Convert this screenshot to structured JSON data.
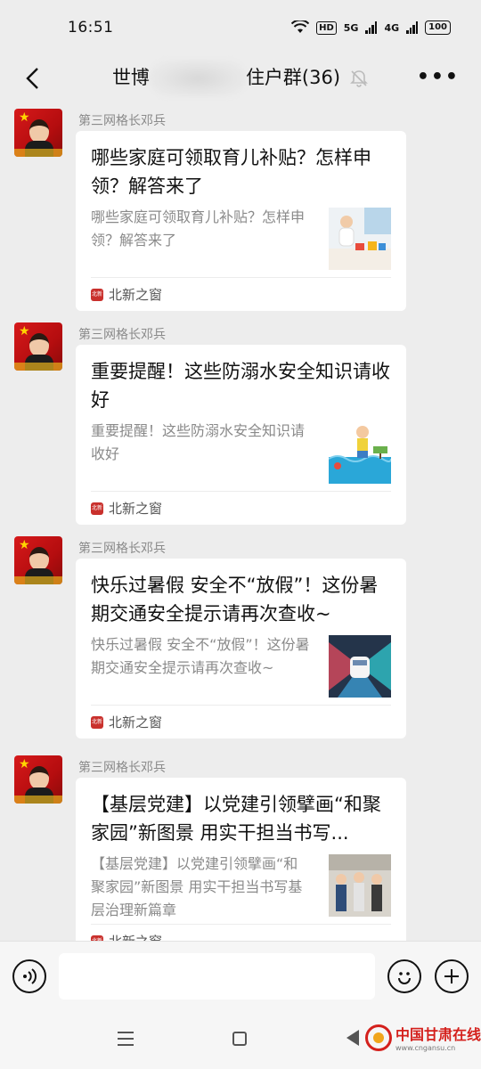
{
  "status_bar": {
    "time": "16:51",
    "hd_label": "HD",
    "net1": "5G",
    "net2": "4G",
    "battery": "100"
  },
  "header": {
    "title_prefix": "世博",
    "title_suffix": "住户群(36)",
    "back_icon": "chevron-left-icon",
    "mute_icon": "bell-off-icon",
    "more_icon": "more-icon"
  },
  "messages": [
    {
      "sender": "第三网格长邓兵",
      "title": "哪些家庭可领取育儿补贴？怎样申领？解答来了",
      "desc": "哪些家庭可领取育儿补贴？怎样申领？解答来了",
      "source": "北新之窗",
      "thumb": "baby-photo"
    },
    {
      "sender": "第三网格长邓兵",
      "title": "重要提醒！这些防溺水安全知识请收好",
      "desc": "重要提醒！这些防溺水安全知识请收好",
      "source": "北新之窗",
      "thumb": "water-safety-cartoon"
    },
    {
      "sender": "第三网格长邓兵",
      "title": "快乐过暑假 安全不“放假”！这份暑期交通安全提示请再次查收~",
      "desc": "快乐过暑假 安全不“放假”！这份暑期交通安全提示请再次查收~",
      "source": "北新之窗",
      "thumb": "car-blind-spot-diagram"
    },
    {
      "sender": "第三网格长邓兵",
      "title": "【基层党建】以党建引领擘画“和聚家园”新图景 用实干担当书写...",
      "desc": "【基层党建】以党建引领擘画“和聚家园”新图景 用实干担当书写基层治理新篇章",
      "source": "北新之窗",
      "thumb": "community-meeting-photo"
    }
  ],
  "input_bar": {
    "voice_icon": "voice-icon",
    "emoji_icon": "emoji-icon",
    "add_icon": "plus-icon",
    "input_value": ""
  },
  "watermark": {
    "main": "中国甘肃在线",
    "sub": "www.cngansu.cn"
  },
  "colors": {
    "background": "#ededed",
    "card": "#ffffff",
    "muted_text": "#8a8a8a",
    "source_red": "#c9302c",
    "watermark_red": "#d4201c"
  }
}
